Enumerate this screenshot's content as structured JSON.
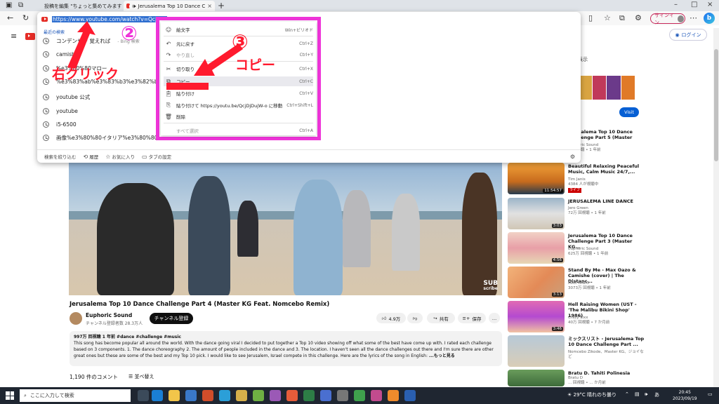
{
  "browser": {
    "tabs": [
      {
        "label": "投稿を編集 \"ちょっと集めてみます"
      },
      {
        "label": "Jerusalema Top 10 Dance C"
      }
    ],
    "signin_label": "サインイン"
  },
  "omnibox": {
    "url": "https://www.youtube.com/watch?v=QcjDjD",
    "recent_title": "最近の検索",
    "bing_hint": "- Bing 検索",
    "suggestions": [
      "コンデンサー 覚えれば",
      "camishe",
      "%e3%80%80マロー",
      "%e3%83%ab%e3%83%b3%e3%82%b0 画像",
      "youtube 公式",
      "youtube",
      "i5-6500",
      "画像%e3%80%80イタリア%e3%80%80マロー"
    ],
    "footer": {
      "narrow_label": "検索を絞り込む",
      "history": "履歴",
      "favorites": "お気に入り",
      "tabs": "タブの設定"
    }
  },
  "context_menu": {
    "items": [
      {
        "label": "絵文字",
        "shortcut": "Win+ピリオド",
        "icon": "emoji-icon"
      },
      {
        "label": "元に戻す",
        "shortcut": "Ctrl+Z",
        "icon": "undo-icon"
      },
      {
        "label": "やり直し",
        "shortcut": "Ctrl+Y",
        "icon": "redo-icon"
      },
      {
        "label": "切り取り",
        "shortcut": "Ctrl+X",
        "icon": "cut-icon"
      },
      {
        "label": "コピー",
        "shortcut": "Ctrl+C",
        "icon": "copy-icon"
      },
      {
        "label": "貼り付け",
        "shortcut": "Ctrl+V",
        "icon": "paste-icon"
      },
      {
        "label": "貼り付けて https://youtu.be/QcjDjDujW-o に移動",
        "shortcut": "Ctrl+Shift+L",
        "icon": "paste-go-icon"
      },
      {
        "label": "削除",
        "shortcut": "",
        "icon": "delete-icon"
      },
      {
        "label": "すべて選択",
        "shortcut": "Ctrl+A",
        "icon": ""
      }
    ]
  },
  "annotations": {
    "step2": "②",
    "step3": "③",
    "right_click": "右クリック",
    "copy": "コピー"
  },
  "youtube": {
    "login": "ログイン",
    "chips_right": "レイを表示",
    "video_badge_top": "SUB",
    "video_badge_bottom": "scribe",
    "title": "Jerusalema Top 10 Dance Challenge Part 4 (Master KG Feat. Nomcebo Remix)",
    "channel": "Euphoric Sound",
    "channel_subs": "チャンネル登録者数 28.3万人",
    "subscribe": "チャンネル登録",
    "likes": "4.9万",
    "share": "共有",
    "save": "保存",
    "more": "…",
    "description": {
      "stats": "997万 回視聴  1 年前  #dance #challenge #music",
      "text": "This song has become popular all around the world. With the dance going viral I decided to put together a Top 10 video showing off what some of the best have come up with. I rated each challenge based on 3 components. 1. The dance choreography 2. The amount of people included in the dance and 3. The location. I haven't seen all the dance challenges out there and I'm sure there are other great ones but these are some of the best and my Top 10 pick. I would like to see Jerusalem, Israel compete in this challenge. Here are the lyrics of the song in English: ",
      "more": "...もっと見る"
    },
    "comments": "1,190 件のコメント",
    "sort": "並べ替え",
    "ad_visit": "Visit",
    "recommendations": [
      {
        "title": "Jerusalema Top 10 Dance Challenge Part 5 (Master KG...",
        "channel": "Euphoric Sound",
        "meta": "... 回視聴 • 1 年前",
        "duration": ""
      },
      {
        "title": "Beautiful Relaxing Peaceful Music, Calm Music 24/7,...",
        "channel": "Tim Janis",
        "meta": "4384 人が視聴中",
        "duration": "11:54:57",
        "live": "ライブ"
      },
      {
        "title": "JERUSALEMA LINE DANCE",
        "channel": "Jero Green",
        "meta": "72万 回視聴 • 1 年前",
        "duration": "3:03"
      },
      {
        "title": "Jerusalema Top 10 Dance Challenge Part 3 (Master KG...",
        "channel": "Euphoric Sound",
        "meta": "625万 回視聴 • 1 年前",
        "duration": "4:56"
      },
      {
        "title": "Stand By Me - Max Oazo & Camishe (cover) | The Distanc...",
        "channel": "MAX OAZO",
        "meta": "3073万 回視聴 • 1 年前",
        "duration": "3:13"
      },
      {
        "title": "Hell Raising Women (UST - 'The Malibu Bikini Shop' 1986)",
        "channel": "Crazy Lixx",
        "meta": "40万 回視聴 • 7 か月前",
        "duration": "3:46"
      },
      {
        "title": "ミックスリスト - Jerusalema Top 10 Dance Challenge Part ...",
        "channel": "Nomcebo Zikode、Master KG、ジョイなど",
        "meta": "",
        "duration": ""
      },
      {
        "title": "Bratu D. Tahiti Polinesia",
        "channel": "Bratu D",
        "meta": "... 回視聴 • ... か月前",
        "duration": ""
      }
    ]
  },
  "taskbar": {
    "search_placeholder": "ここに入力して検索",
    "weather": "29°C 晴れのち曇り",
    "ime": "あ",
    "time": "20:45",
    "date": "2023/09/19"
  },
  "colors": {
    "annotation_red": "#ff1a2e",
    "annotation_magenta": "#ee34d8",
    "url_highlight": "#2f6fd0",
    "youtube_red": "#e52d27"
  }
}
